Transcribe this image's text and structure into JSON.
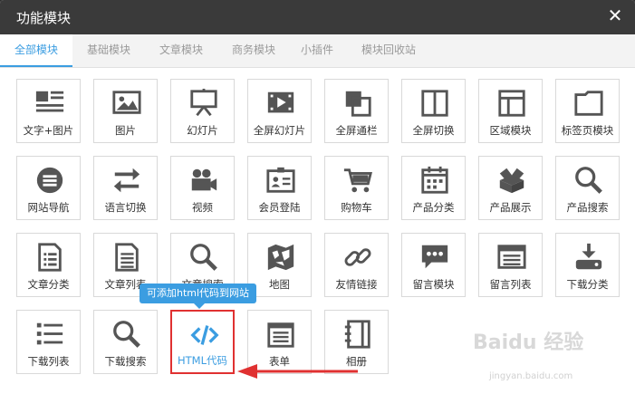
{
  "dialog": {
    "title": "功能模块",
    "close_label": "✕"
  },
  "tabs": [
    {
      "label": "全部模块",
      "active": true
    },
    {
      "label": "基础模块"
    },
    {
      "label": "文章模块"
    },
    {
      "label": "商务模块"
    },
    {
      "label": "小插件"
    },
    {
      "label": "模块回收站"
    }
  ],
  "modules": [
    {
      "label": "文字+图片",
      "icon": "text-image-icon"
    },
    {
      "label": "图片",
      "icon": "image-icon"
    },
    {
      "label": "幻灯片",
      "icon": "slideshow-icon"
    },
    {
      "label": "全屏幻灯片",
      "icon": "fullscreen-slideshow-icon"
    },
    {
      "label": "全屏通栏",
      "icon": "fullscreen-banner-icon"
    },
    {
      "label": "全屏切换",
      "icon": "fullscreen-switch-icon"
    },
    {
      "label": "区域模块",
      "icon": "region-module-icon"
    },
    {
      "label": "标签页模块",
      "icon": "tab-page-icon"
    },
    {
      "label": "网站导航",
      "icon": "site-nav-icon"
    },
    {
      "label": "语言切换",
      "icon": "language-switch-icon"
    },
    {
      "label": "视频",
      "icon": "video-icon"
    },
    {
      "label": "会员登陆",
      "icon": "member-login-icon"
    },
    {
      "label": "购物车",
      "icon": "cart-icon"
    },
    {
      "label": "产品分类",
      "icon": "product-category-icon"
    },
    {
      "label": "产品展示",
      "icon": "product-display-icon"
    },
    {
      "label": "产品搜索",
      "icon": "product-search-icon"
    },
    {
      "label": "文章分类",
      "icon": "article-category-icon"
    },
    {
      "label": "文章列表",
      "icon": "article-list-icon"
    },
    {
      "label": "文章搜索",
      "icon": "article-search-icon"
    },
    {
      "label": "地图",
      "icon": "map-icon"
    },
    {
      "label": "友情链接",
      "icon": "link-icon"
    },
    {
      "label": "留言模块",
      "icon": "message-module-icon"
    },
    {
      "label": "留言列表",
      "icon": "message-list-icon"
    },
    {
      "label": "下载分类",
      "icon": "download-category-icon"
    },
    {
      "label": "下载列表",
      "icon": "download-list-icon"
    },
    {
      "label": "下载搜索",
      "icon": "download-search-icon"
    },
    {
      "label": "HTML代码",
      "icon": "html-code-icon",
      "highlighted": true
    },
    {
      "label": "表单",
      "icon": "form-icon"
    },
    {
      "label": "相册",
      "icon": "album-icon"
    }
  ],
  "tooltip": {
    "text": "可添加html代码到网站"
  },
  "watermark": {
    "logo": "Baidu 经验",
    "url": "jingyan.baidu.com"
  },
  "colors": {
    "accent": "#3b9de1",
    "icon": "#555555",
    "highlight": "#e03131",
    "titlebar": "#3a3a3a"
  }
}
